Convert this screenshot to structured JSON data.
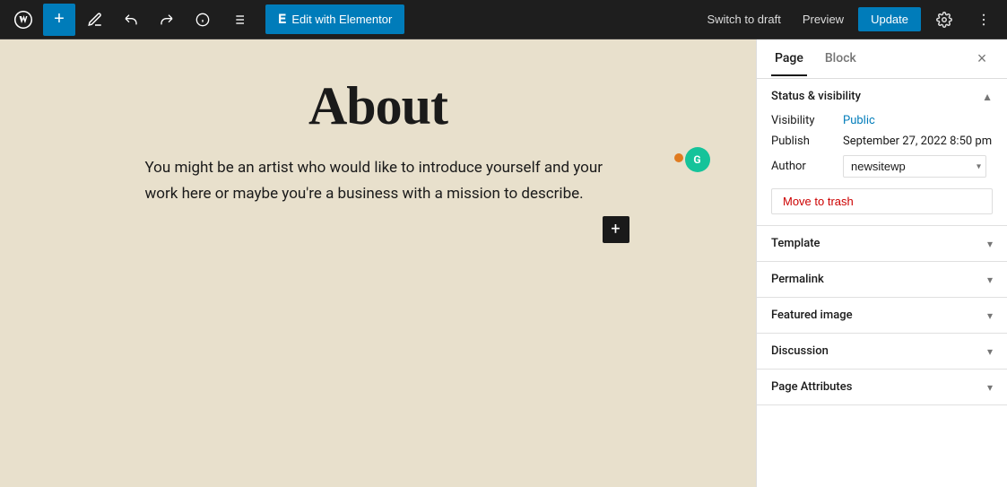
{
  "toolbar": {
    "add_label": "+",
    "undo_label": "↺",
    "redo_label": "↻",
    "info_label": "ⓘ",
    "list_label": "≡",
    "elementor_label": "Edit with Elementor",
    "elementor_icon": "E",
    "switch_draft_label": "Switch to draft",
    "preview_label": "Preview",
    "update_label": "Update"
  },
  "canvas": {
    "page_title": "About",
    "page_body": "You might be an artist who would like to introduce yourself and your work here or maybe you're a business with a mission to describe."
  },
  "sidebar": {
    "tab_page": "Page",
    "tab_block": "Block",
    "close_label": "×",
    "status_visibility": {
      "title": "Status & visibility",
      "visibility_label": "Visibility",
      "visibility_value": "Public",
      "publish_label": "Publish",
      "publish_value": "September 27, 2022 8:50 pm",
      "author_label": "Author",
      "author_value": "newsitewp",
      "move_trash_label": "Move to trash"
    },
    "template": {
      "title": "Template"
    },
    "permalink": {
      "title": "Permalink"
    },
    "featured_image": {
      "title": "Featured image"
    },
    "discussion": {
      "title": "Discussion"
    },
    "page_attributes": {
      "title": "Page Attributes"
    }
  }
}
